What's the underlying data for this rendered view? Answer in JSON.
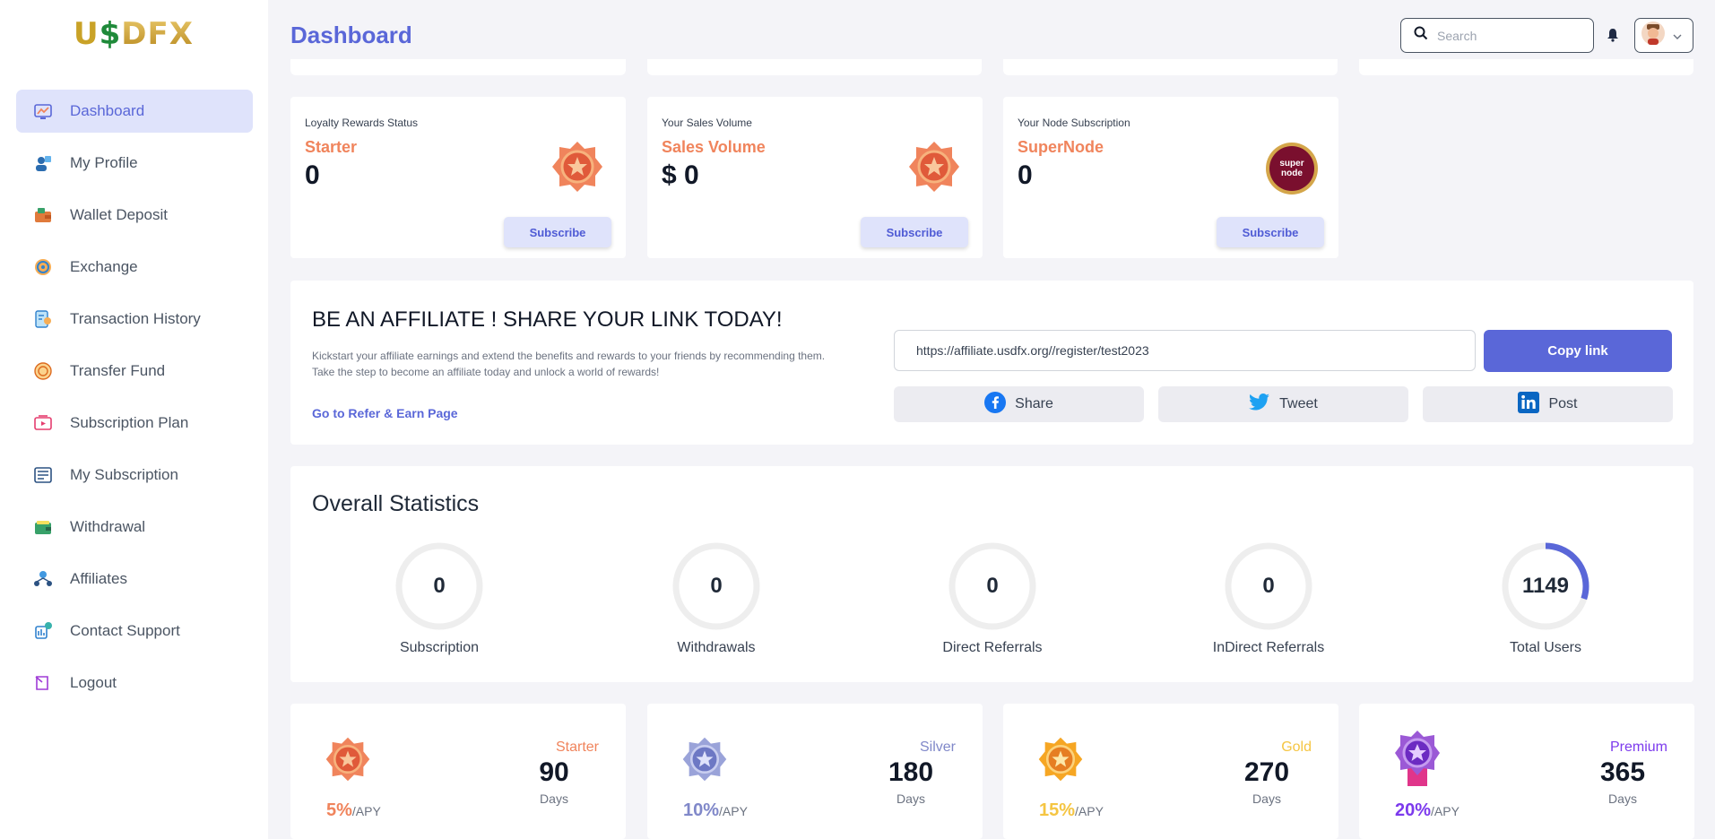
{
  "brand": {
    "logo_u": "U",
    "logo_s": "$",
    "logo_rest": "DFX"
  },
  "header": {
    "title": "Dashboard",
    "search_placeholder": "Search"
  },
  "sidebar": {
    "items": [
      {
        "label": "Dashboard",
        "icon": "dashboard-icon"
      },
      {
        "label": "My Profile",
        "icon": "profile-icon"
      },
      {
        "label": "Wallet Deposit",
        "icon": "wallet-deposit-icon"
      },
      {
        "label": "Exchange",
        "icon": "exchange-icon"
      },
      {
        "label": "Transaction History",
        "icon": "transaction-history-icon"
      },
      {
        "label": "Transfer Fund",
        "icon": "transfer-fund-icon"
      },
      {
        "label": "Subscription Plan",
        "icon": "subscription-plan-icon"
      },
      {
        "label": "My Subscription",
        "icon": "my-subscription-icon"
      },
      {
        "label": "Withdrawal",
        "icon": "withdrawal-icon"
      },
      {
        "label": "Affiliates",
        "icon": "affiliates-icon"
      },
      {
        "label": "Contact Support",
        "icon": "contact-support-icon"
      },
      {
        "label": "Logout",
        "icon": "logout-icon"
      }
    ]
  },
  "rewards": [
    {
      "label": "Loyalty Rewards Status",
      "tier": "Starter",
      "value": "0",
      "button": "Subscribe",
      "badge": "starter-medal-icon"
    },
    {
      "label": "Your Sales Volume",
      "tier": "Sales Volume",
      "value": "$ 0",
      "button": "Subscribe",
      "badge": "starter-medal-icon"
    },
    {
      "label": "Your Node Subscription",
      "tier": "SuperNode",
      "value": "0",
      "button": "Subscribe",
      "badge": "supernode-badge-icon",
      "badge_text": "super node"
    }
  ],
  "affiliate": {
    "title": "BE AN AFFILIATE ! SHARE YOUR LINK TODAY!",
    "desc_line1": "Kickstart your affiliate earnings and extend the benefits and rewards to your friends by recommending them.",
    "desc_line2": "Take the step to become an affiliate today and unlock a world of rewards!",
    "link_text": "Go to Refer & Earn Page",
    "url": "https://affiliate.usdfx.org//register/test2023",
    "copy": "Copy link",
    "share": "Share",
    "tweet": "Tweet",
    "post": "Post"
  },
  "stats": {
    "title": "Overall Statistics",
    "items": [
      {
        "value": "0",
        "label": "Subscription",
        "fraction": 0
      },
      {
        "value": "0",
        "label": "Withdrawals",
        "fraction": 0
      },
      {
        "value": "0",
        "label": "Direct Referrals",
        "fraction": 0
      },
      {
        "value": "0",
        "label": "InDirect Referrals",
        "fraction": 0
      },
      {
        "value": "1149",
        "label": "Total Users",
        "fraction": 0.3
      }
    ]
  },
  "plans": [
    {
      "name": "Starter",
      "days": "90",
      "days_label": "Days",
      "apy": "5%",
      "apy_suffix": "/APY",
      "color": "#f0845c"
    },
    {
      "name": "Silver",
      "days": "180",
      "days_label": "Days",
      "apy": "10%",
      "apy_suffix": "/APY",
      "color": "#8088c9"
    },
    {
      "name": "Gold",
      "days": "270",
      "days_label": "Days",
      "apy": "15%",
      "apy_suffix": "/APY",
      "color": "#f5c542"
    },
    {
      "name": "Premium",
      "days": "365",
      "days_label": "Days",
      "apy": "20%",
      "apy_suffix": "/APY",
      "color": "#7c3aed"
    }
  ],
  "colors": {
    "accent": "#5a67d8",
    "ring_track": "#eeeeee",
    "orange": "#f0845c"
  }
}
